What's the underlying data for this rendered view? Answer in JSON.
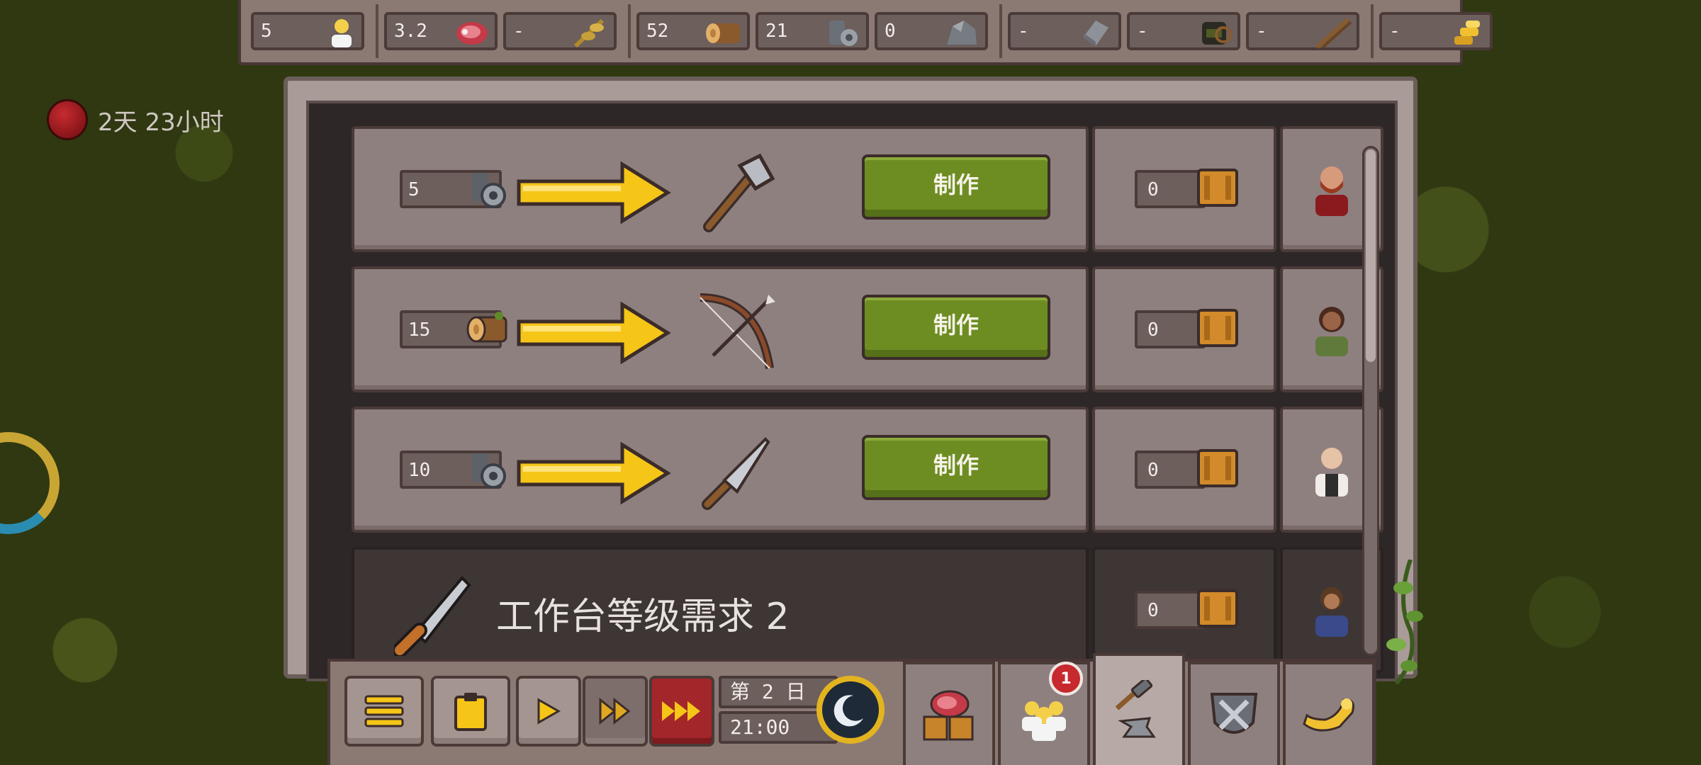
{
  "resources": [
    {
      "value": "5",
      "icon": "population-icon"
    },
    {
      "value": "3.2",
      "icon": "meat-icon"
    },
    {
      "value": "-",
      "icon": "wheat-icon"
    },
    {
      "value": "52",
      "icon": "wood-log-icon"
    },
    {
      "value": "21",
      "icon": "iron-ore-icon"
    },
    {
      "value": "0",
      "icon": "stone-icon"
    },
    {
      "value": "-",
      "icon": "iron-ingot-icon"
    },
    {
      "value": "-",
      "icon": "leather-icon"
    },
    {
      "value": "-",
      "icon": "arrows-icon"
    },
    {
      "value": "-",
      "icon": "gold-coins-icon"
    }
  ],
  "timer": {
    "label": "2天 23小时"
  },
  "recipes": [
    {
      "cost": "5",
      "cost_icon": "iron-ore-icon",
      "product_icon": "axe-icon",
      "button": "制作",
      "stock": "0",
      "worker_icon": "worker-bearded-icon"
    },
    {
      "cost": "15",
      "cost_icon": "wood-log-icon",
      "product_icon": "bow-icon",
      "button": "制作",
      "stock": "0",
      "worker_icon": "worker-woman-icon"
    },
    {
      "cost": "10",
      "cost_icon": "iron-ore-icon",
      "product_icon": "knife-icon",
      "button": "制作",
      "stock": "0",
      "worker_icon": "worker-bald-icon"
    }
  ],
  "locked": {
    "text": "工作台等级需求 2",
    "stock": "0",
    "icon": "saw-icon",
    "worker_icon": "worker-girl-icon"
  },
  "clock": {
    "day": "第 2 日",
    "time": "21:00"
  },
  "tabs": {
    "notification_badge": "1"
  },
  "colors": {
    "make_button": "#6d8d22",
    "arrow": "#f5c518",
    "panel": "#8f8080",
    "pause_button": "#a3262a"
  }
}
